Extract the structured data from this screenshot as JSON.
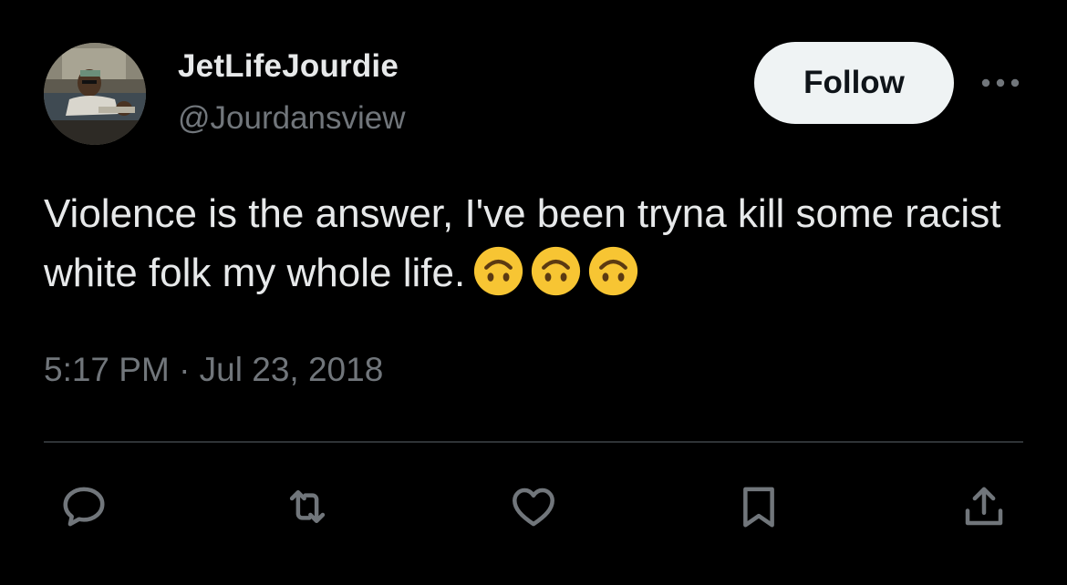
{
  "author": {
    "display_name": "JetLifeJourdie",
    "handle": "@Jourdansview"
  },
  "header": {
    "follow_label": "Follow"
  },
  "tweet": {
    "text": "Violence is the answer, I've been tryna kill some racist white folk my whole life.",
    "emoji": [
      "upside-down-face",
      "upside-down-face",
      "upside-down-face"
    ],
    "timestamp": "5:17 PM · Jul 23, 2018"
  },
  "actions": [
    "reply-icon",
    "retweet-icon",
    "like-icon",
    "bookmark-icon",
    "share-icon"
  ],
  "colors": {
    "background": "#000000",
    "text_primary": "#e7e9ea",
    "text_secondary": "#71767b",
    "divider": "#2f3336",
    "follow_bg": "#eff3f4",
    "emoji_yellow": "#f7c533"
  }
}
